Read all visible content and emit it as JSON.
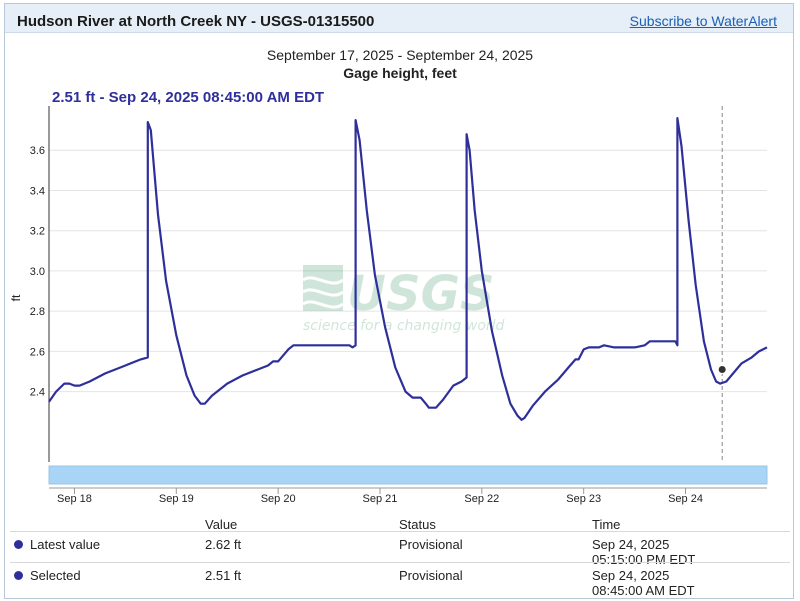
{
  "header": {
    "site_title": "Hudson River at North Creek NY - USGS-01315500",
    "subscribe_label": "Subscribe to WaterAlert"
  },
  "chart_header": {
    "date_range": "September 17, 2025 - September 24, 2025",
    "series_title": "Gage height, feet",
    "tooltip": "2.51 ft - Sep 24, 2025 08:45:00 AM EDT"
  },
  "chart_data": {
    "type": "line",
    "title": "Gage height, feet",
    "xlabel": "",
    "ylabel": "ft",
    "x_unit": "days since Sep 18 00:00",
    "xlim": [
      -0.25,
      6.8
    ],
    "ylim": [
      2.05,
      3.82
    ],
    "yticks": [
      2.4,
      2.6,
      2.8,
      3.0,
      3.2,
      3.4,
      3.6
    ],
    "ytick_labels": [
      "2.4",
      "2.6",
      "2.8",
      "3.0",
      "3.2",
      "3.4",
      "3.6"
    ],
    "xticks": [
      0,
      1,
      2,
      3,
      4,
      5,
      6
    ],
    "xtick_labels": [
      "Sep 18",
      "Sep 19",
      "Sep 20",
      "Sep 21",
      "Sep 22",
      "Sep 23",
      "Sep 24"
    ],
    "grid": true,
    "line_color": "#2f2f9b",
    "watermark": "USGS science for a changing world",
    "selected_point": {
      "x": 6.36,
      "y": 2.51
    },
    "series": [
      {
        "points": [
          [
            -0.25,
            2.35
          ],
          [
            -0.18,
            2.4
          ],
          [
            -0.1,
            2.44
          ],
          [
            -0.05,
            2.44
          ],
          [
            0.0,
            2.43
          ],
          [
            0.05,
            2.43
          ],
          [
            0.15,
            2.45
          ],
          [
            0.3,
            2.49
          ],
          [
            0.5,
            2.53
          ],
          [
            0.65,
            2.56
          ],
          [
            0.72,
            2.57
          ],
          [
            0.72,
            3.74
          ],
          [
            0.75,
            3.7
          ],
          [
            0.82,
            3.28
          ],
          [
            0.9,
            2.95
          ],
          [
            1.0,
            2.68
          ],
          [
            1.1,
            2.48
          ],
          [
            1.18,
            2.38
          ],
          [
            1.24,
            2.34
          ],
          [
            1.28,
            2.34
          ],
          [
            1.35,
            2.38
          ],
          [
            1.5,
            2.44
          ],
          [
            1.65,
            2.48
          ],
          [
            1.8,
            2.51
          ],
          [
            1.9,
            2.53
          ],
          [
            1.95,
            2.55
          ],
          [
            2.0,
            2.55
          ],
          [
            2.05,
            2.58
          ],
          [
            2.1,
            2.61
          ],
          [
            2.15,
            2.63
          ],
          [
            2.4,
            2.63
          ],
          [
            2.7,
            2.63
          ],
          [
            2.73,
            2.62
          ],
          [
            2.76,
            2.63
          ],
          [
            2.76,
            3.75
          ],
          [
            2.8,
            3.65
          ],
          [
            2.87,
            3.3
          ],
          [
            2.95,
            2.98
          ],
          [
            3.05,
            2.72
          ],
          [
            3.15,
            2.52
          ],
          [
            3.25,
            2.4
          ],
          [
            3.32,
            2.37
          ],
          [
            3.4,
            2.37
          ],
          [
            3.45,
            2.34
          ],
          [
            3.48,
            2.32
          ],
          [
            3.55,
            2.32
          ],
          [
            3.62,
            2.36
          ],
          [
            3.72,
            2.43
          ],
          [
            3.8,
            2.45
          ],
          [
            3.85,
            2.47
          ],
          [
            3.85,
            3.68
          ],
          [
            3.88,
            3.6
          ],
          [
            3.93,
            3.3
          ],
          [
            4.0,
            3.0
          ],
          [
            4.1,
            2.7
          ],
          [
            4.2,
            2.48
          ],
          [
            4.28,
            2.34
          ],
          [
            4.35,
            2.28
          ],
          [
            4.39,
            2.26
          ],
          [
            4.42,
            2.27
          ],
          [
            4.5,
            2.33
          ],
          [
            4.62,
            2.4
          ],
          [
            4.75,
            2.46
          ],
          [
            4.85,
            2.52
          ],
          [
            4.92,
            2.56
          ],
          [
            4.95,
            2.56
          ],
          [
            5.0,
            2.61
          ],
          [
            5.05,
            2.62
          ],
          [
            5.15,
            2.62
          ],
          [
            5.2,
            2.63
          ],
          [
            5.3,
            2.62
          ],
          [
            5.5,
            2.62
          ],
          [
            5.6,
            2.63
          ],
          [
            5.65,
            2.65
          ],
          [
            5.75,
            2.65
          ],
          [
            5.9,
            2.65
          ],
          [
            5.92,
            2.63
          ],
          [
            5.92,
            3.76
          ],
          [
            5.96,
            3.62
          ],
          [
            6.03,
            3.25
          ],
          [
            6.1,
            2.93
          ],
          [
            6.18,
            2.65
          ],
          [
            6.25,
            2.51
          ],
          [
            6.3,
            2.45
          ],
          [
            6.34,
            2.44
          ],
          [
            6.4,
            2.45
          ],
          [
            6.5,
            2.51
          ],
          [
            6.55,
            2.54
          ],
          [
            6.65,
            2.57
          ],
          [
            6.72,
            2.6
          ],
          [
            6.8,
            2.62
          ]
        ]
      }
    ]
  },
  "table": {
    "headers": [
      "Value",
      "Status",
      "Time"
    ],
    "rows": [
      {
        "label": "Latest value",
        "value": "2.62 ft",
        "status": "Provisional",
        "time1": "Sep 24, 2025",
        "time2": "05:15:00 PM EDT"
      },
      {
        "label": "Selected",
        "value": "2.51 ft",
        "status": "Provisional",
        "time1": "Sep 24, 2025",
        "time2": "08:45:00 AM EDT"
      }
    ]
  }
}
